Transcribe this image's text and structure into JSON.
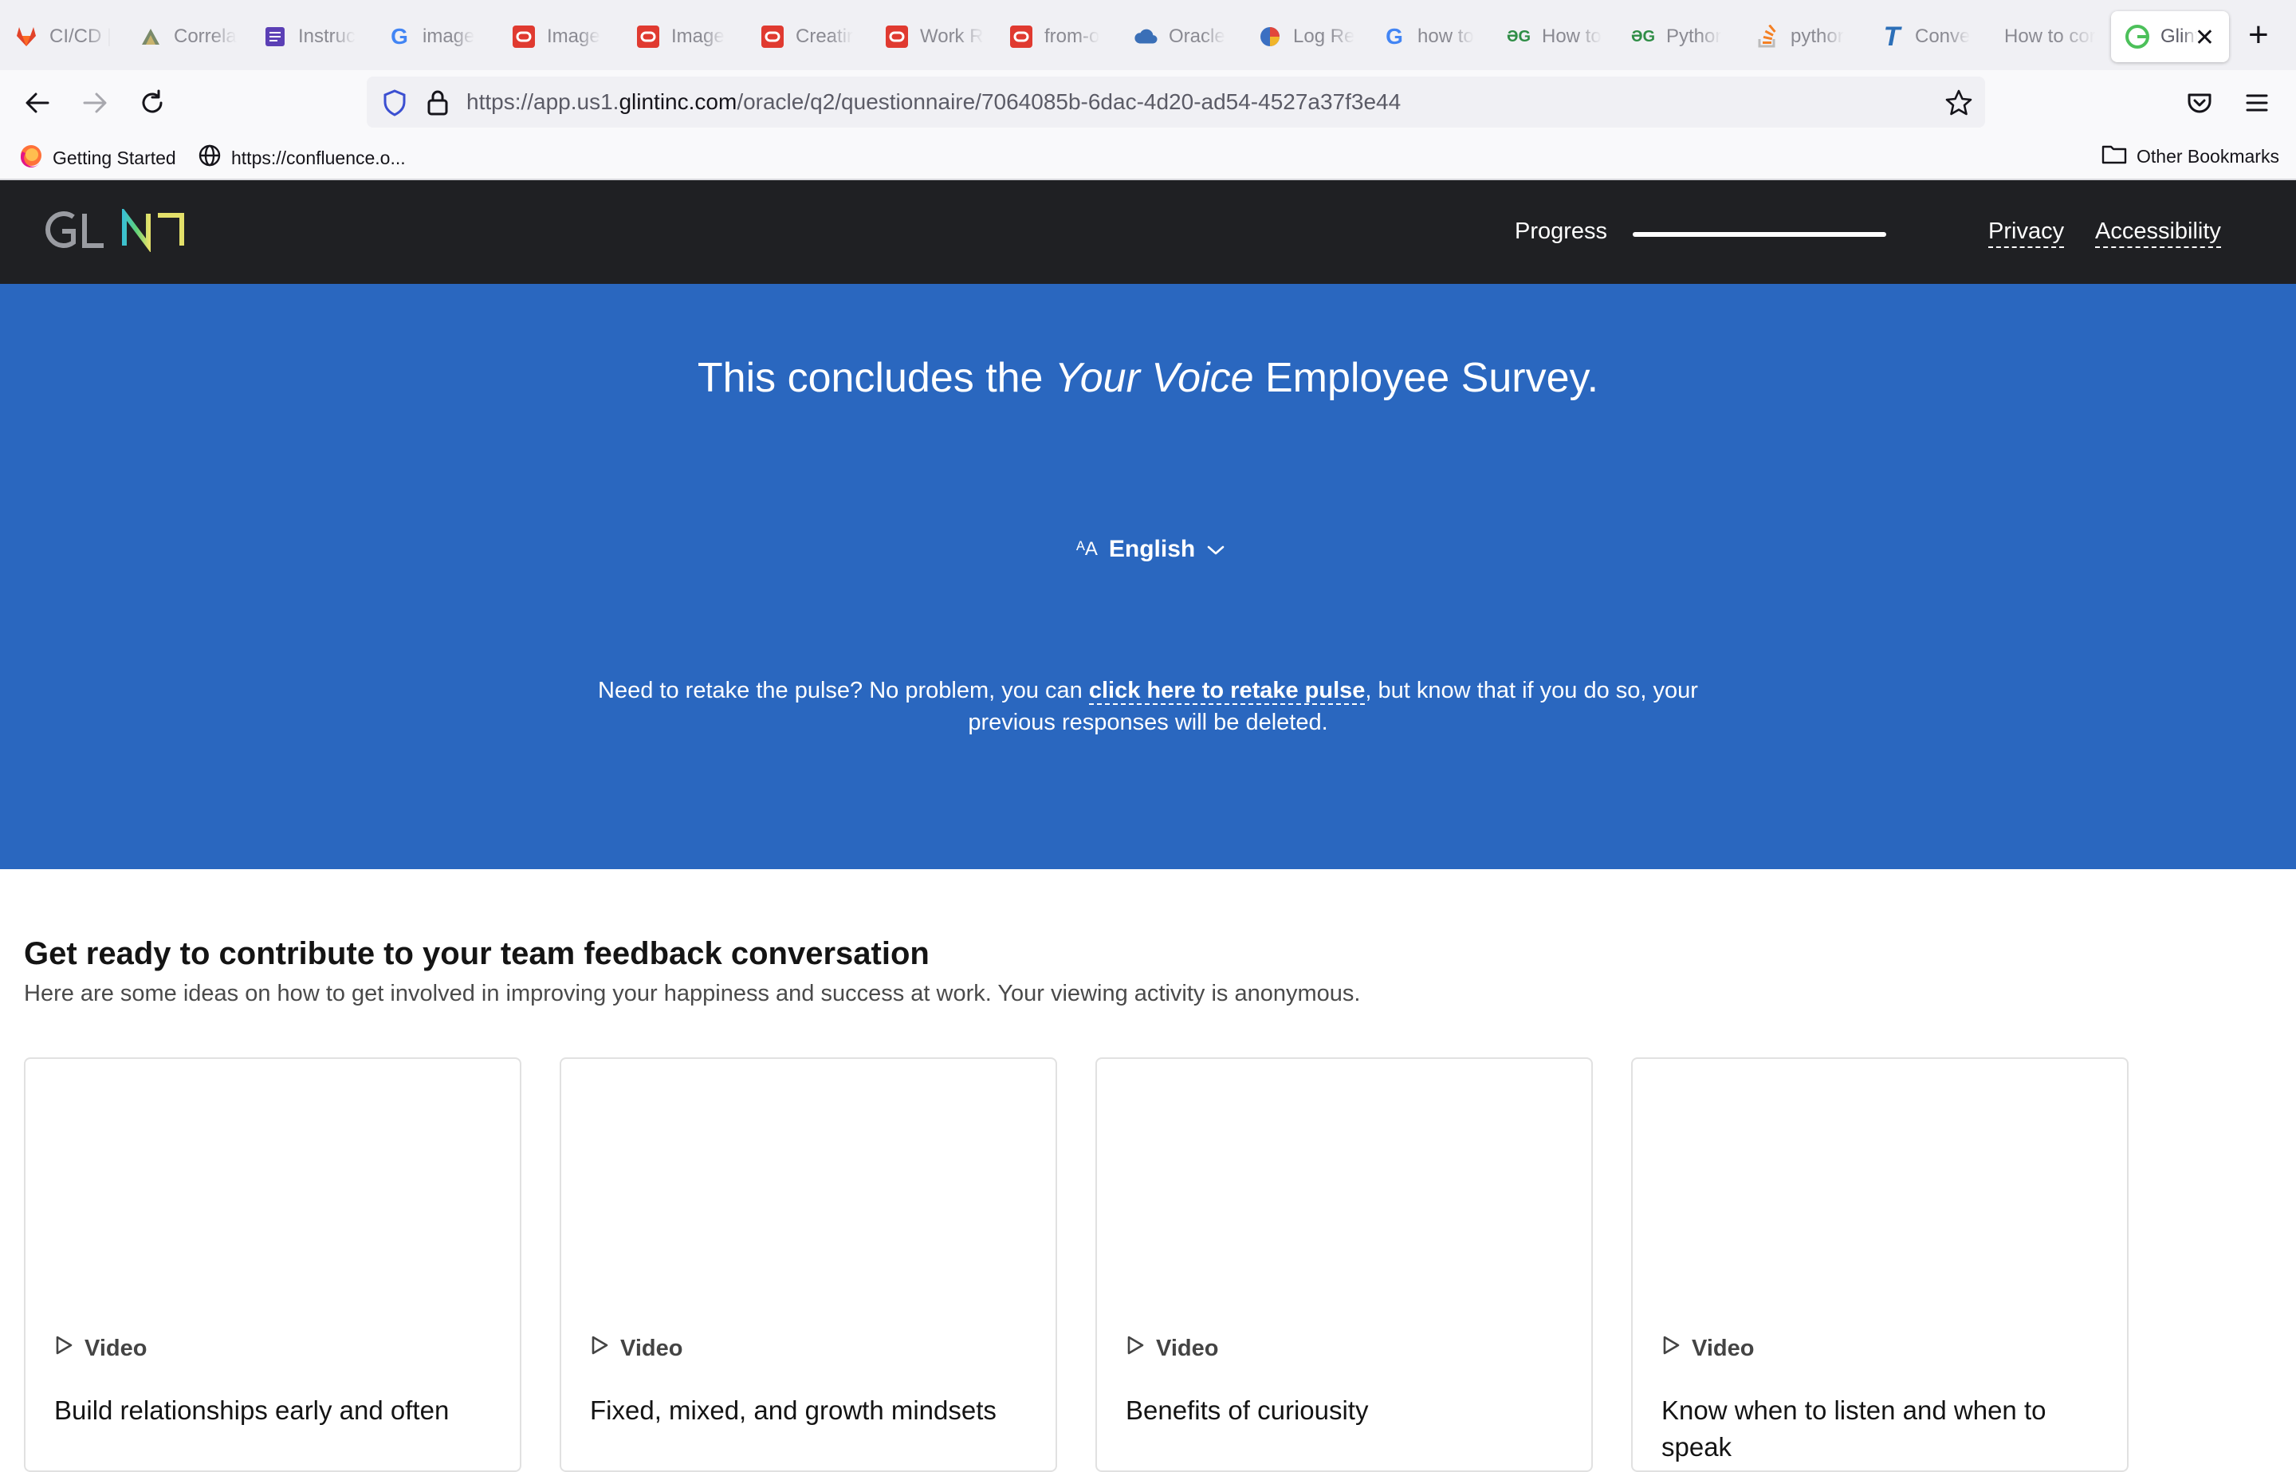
{
  "browser": {
    "tabs": [
      {
        "label": "CI/CD |",
        "icon": "gitlab-icon"
      },
      {
        "label": "Correla",
        "icon": "correlation-icon"
      },
      {
        "label": "Instruc",
        "icon": "document-icon"
      },
      {
        "label": "image",
        "icon": "google-icon"
      },
      {
        "label": "Image",
        "icon": "oracle-icon"
      },
      {
        "label": "Image",
        "icon": "oracle-icon"
      },
      {
        "label": "Creatir",
        "icon": "oracle-icon"
      },
      {
        "label": "Work R",
        "icon": "oracle-icon"
      },
      {
        "label": "from-o",
        "icon": "oracle-icon"
      },
      {
        "label": "Oracle",
        "icon": "cloud-icon"
      },
      {
        "label": "Log Re",
        "icon": "shield-logo-icon"
      },
      {
        "label": "how to",
        "icon": "google-icon"
      },
      {
        "label": "How to",
        "icon": "geeks-icon"
      },
      {
        "label": "Pythor",
        "icon": "geeks-icon"
      },
      {
        "label": "pythor",
        "icon": "stackoverflow-icon"
      },
      {
        "label": "Conve",
        "icon": "t-logo-icon"
      },
      {
        "label": "How to cor",
        "icon": ""
      },
      {
        "label": "Glint",
        "icon": "glint-icon",
        "active": true
      }
    ],
    "url_prefix": "https://app.us1.",
    "url_host": "glintinc.com",
    "url_path": "/oracle/q2/questionnaire/7064085b-6dac-4d20-ad54-4527a37f3e44",
    "bookmarks": [
      "Getting Started",
      "https://confluence.o..."
    ],
    "other_bookmarks": "Other Bookmarks"
  },
  "header": {
    "logo_text": "GLINT",
    "progress_label": "Progress",
    "progress_value": 1.0,
    "privacy": "Privacy",
    "accessibility": "Accessibility"
  },
  "hero": {
    "title_pre": "This concludes the ",
    "title_em": "Your Voice",
    "title_post": " Employee Survey.",
    "language": "English",
    "retake_pre": "Need to retake the pulse? No problem, you can ",
    "retake_link": "click here to retake pulse",
    "retake_post": ", but know that if you do so, your previous responses will be deleted."
  },
  "resources": {
    "title": "Get ready to contribute to your team feedback conversation",
    "subtitle": "Here are some ideas on how to get involved in improving your happiness and success at work. Your viewing activity is anonymous.",
    "cards": [
      {
        "kind": "Video",
        "title": "Build relationships early and often"
      },
      {
        "kind": "Video",
        "title": "Fixed, mixed, and growth mindsets"
      },
      {
        "kind": "Video",
        "title": "Benefits of curiousity"
      },
      {
        "kind": "Video",
        "title": "Know when to listen and when to speak"
      }
    ]
  }
}
